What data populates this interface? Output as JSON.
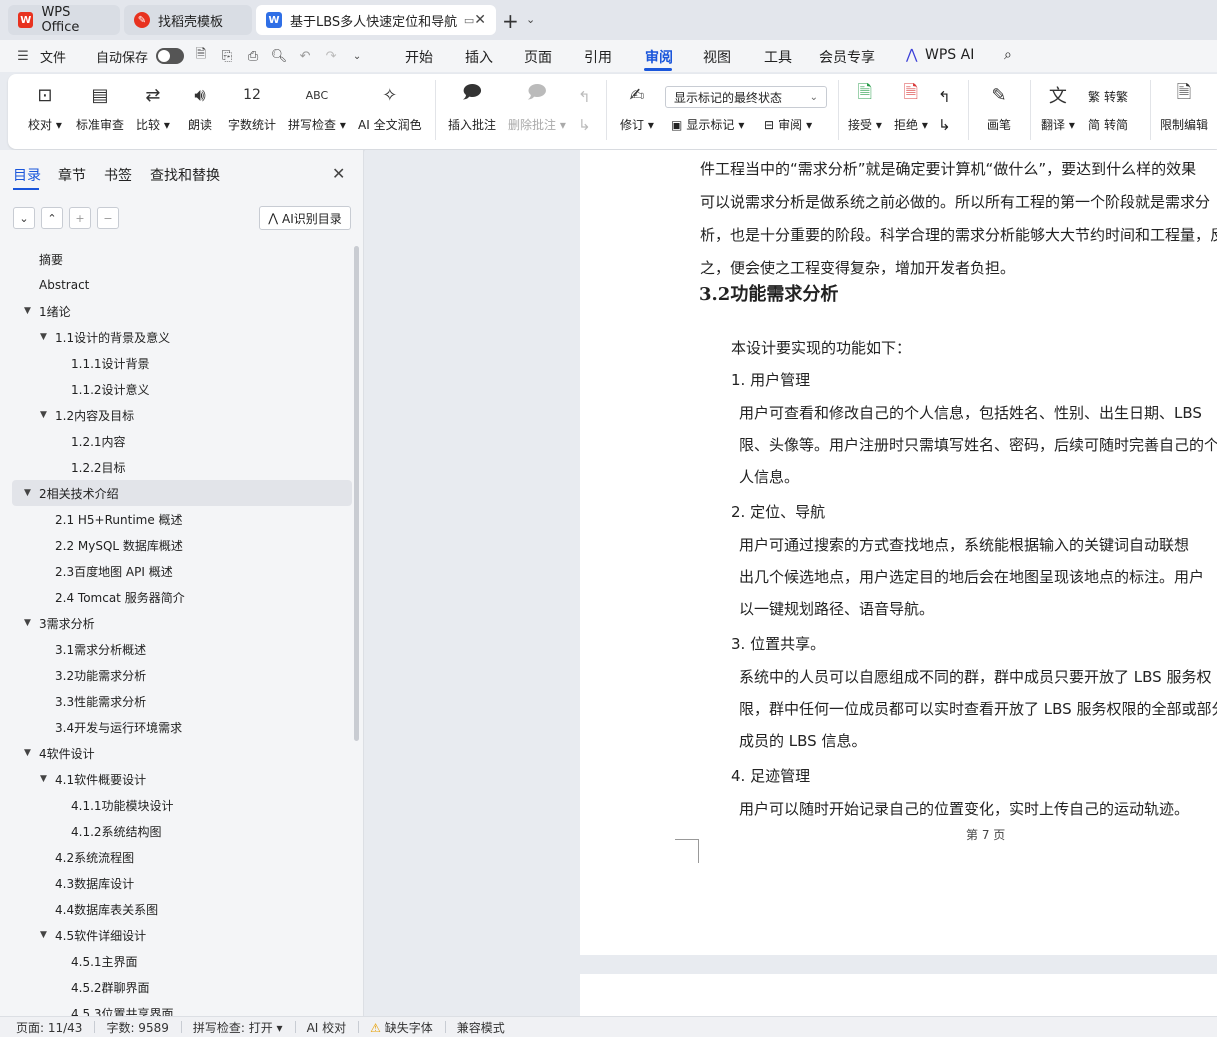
{
  "tabs": {
    "wps": "WPS Office",
    "template": "找稻壳模板",
    "doc": "基于LBS多人快速定位和导航"
  },
  "menubar": {
    "file": "文件",
    "autosave": "自动保存",
    "items": [
      "开始",
      "插入",
      "页面",
      "引用",
      "审阅",
      "视图",
      "工具",
      "会员专享",
      "WPS AI"
    ]
  },
  "ribbon": {
    "proofread": "校对",
    "standard_review": "标准审查",
    "compare": "比较",
    "read_aloud": "朗读",
    "word_count": "字数统计",
    "spell_check": "拼写检查",
    "ai_polish": "AI 全文润色",
    "insert_comment": "插入批注",
    "delete_comment": "删除批注",
    "revise": "修订",
    "display_select": "显示标记的最终状态",
    "show_markup": "显示标记",
    "review": "审阅",
    "accept": "接受",
    "reject": "拒绝",
    "pen": "画笔",
    "translate": "翻译",
    "to_traditional": "转繁",
    "to_simplified": "转简",
    "restrict_edit": "限制编辑"
  },
  "sidepanel": {
    "tabs": [
      "目录",
      "章节",
      "书签",
      "查找和替换"
    ],
    "ai_toc": "AI识别目录",
    "toc": [
      {
        "label": "摘要",
        "level": 0,
        "arrow": false
      },
      {
        "label": "Abstract",
        "level": 0,
        "arrow": false
      },
      {
        "label": "1绪论",
        "level": 0,
        "arrow": true
      },
      {
        "label": "1.1设计的背景及意义",
        "level": 1,
        "arrow": true
      },
      {
        "label": "1.1.1设计背景",
        "level": 2,
        "arrow": false
      },
      {
        "label": "1.1.2设计意义",
        "level": 2,
        "arrow": false
      },
      {
        "label": "1.2内容及目标",
        "level": 1,
        "arrow": true
      },
      {
        "label": "1.2.1内容",
        "level": 2,
        "arrow": false
      },
      {
        "label": "1.2.2目标",
        "level": 2,
        "arrow": false
      },
      {
        "label": "2相关技术介绍",
        "level": 0,
        "arrow": true,
        "selected": true
      },
      {
        "label": "2.1  H5+Runtime 概述",
        "level": 1,
        "arrow": false
      },
      {
        "label": "2.2  MySQL 数据库概述",
        "level": 1,
        "arrow": false
      },
      {
        "label": "2.3百度地图 API 概述",
        "level": 1,
        "arrow": false
      },
      {
        "label": "2.4  Tomcat 服务器简介",
        "level": 1,
        "arrow": false
      },
      {
        "label": "3需求分析",
        "level": 0,
        "arrow": true
      },
      {
        "label": "3.1需求分析概述",
        "level": 1,
        "arrow": false
      },
      {
        "label": "3.2功能需求分析",
        "level": 1,
        "arrow": false
      },
      {
        "label": "3.3性能需求分析",
        "level": 1,
        "arrow": false
      },
      {
        "label": "3.4开发与运行环境需求",
        "level": 1,
        "arrow": false
      },
      {
        "label": "4软件设计",
        "level": 0,
        "arrow": true
      },
      {
        "label": "4.1软件概要设计",
        "level": 1,
        "arrow": true
      },
      {
        "label": "4.1.1功能模块设计",
        "level": 2,
        "arrow": false
      },
      {
        "label": "4.1.2系统结构图",
        "level": 2,
        "arrow": false
      },
      {
        "label": "4.2系统流程图",
        "level": 1,
        "arrow": false
      },
      {
        "label": "4.3数据库设计",
        "level": 1,
        "arrow": false
      },
      {
        "label": "4.4数据库表关系图",
        "level": 1,
        "arrow": false
      },
      {
        "label": "4.5软件详细设计",
        "level": 1,
        "arrow": true
      },
      {
        "label": "4.5.1主界面",
        "level": 2,
        "arrow": false
      },
      {
        "label": "4.5.2群聊界面",
        "level": 2,
        "arrow": false
      },
      {
        "label": "4.5.3位置共享界面",
        "level": 2,
        "arrow": false
      }
    ]
  },
  "document": {
    "lines": [
      "件工程当中的“需求分析”就是确定要计算机“做什么”，要达到什么样的效果",
      "可以说需求分析是做系统之前必做的。所以所有工程的第一个阶段就是需求分",
      "析，也是十分重要的阶段。科学合理的需求分析能够大大节约时间和工程量，反",
      "之，便会使之工程变得复杂，增加开发者负担。"
    ],
    "heading": "3.2功能需求分析",
    "intro": "本设计要实现的功能如下：",
    "items": [
      {
        "title": "1.  用户管理",
        "body": [
          "用户可查看和修改自己的个人信息，包括姓名、性别、出生日期、LBS",
          "限、头像等。用户注册时只需填写姓名、密码，后续可随时完善自己的个",
          "人信息。"
        ]
      },
      {
        "title": "2.  定位、导航",
        "body": [
          "用户可通过搜索的方式查找地点，系统能根据输入的关键词自动联想",
          "出几个候选地点，用户选定目的地后会在地图呈现该地点的标注。用户",
          "以一键规划路径、语音导航。"
        ]
      },
      {
        "title": "3.  位置共享。",
        "body": [
          "系统中的人员可以自愿组成不同的群，群中成员只要开放了 LBS 服务权",
          "限，群中任何一位成员都可以实时查看开放了 LBS 服务权限的全部或部分",
          "成员的 LBS 信息。"
        ]
      },
      {
        "title": "4.  足迹管理",
        "body": [
          "用户可以随时开始记录自己的位置变化，实时上传自己的运动轨迹。"
        ]
      }
    ],
    "page_label": "第 7 页"
  },
  "statusbar": {
    "page": "页面: 11/43",
    "words": "字数: 9589",
    "spell": "拼写检查: 打开",
    "ai_check": "AI 校对",
    "missing_font": "缺失字体",
    "compat": "兼容模式"
  },
  "colors": {
    "accent": "#1a56db",
    "wps_red": "#e8321f",
    "word_blue": "#2f6fe6"
  }
}
